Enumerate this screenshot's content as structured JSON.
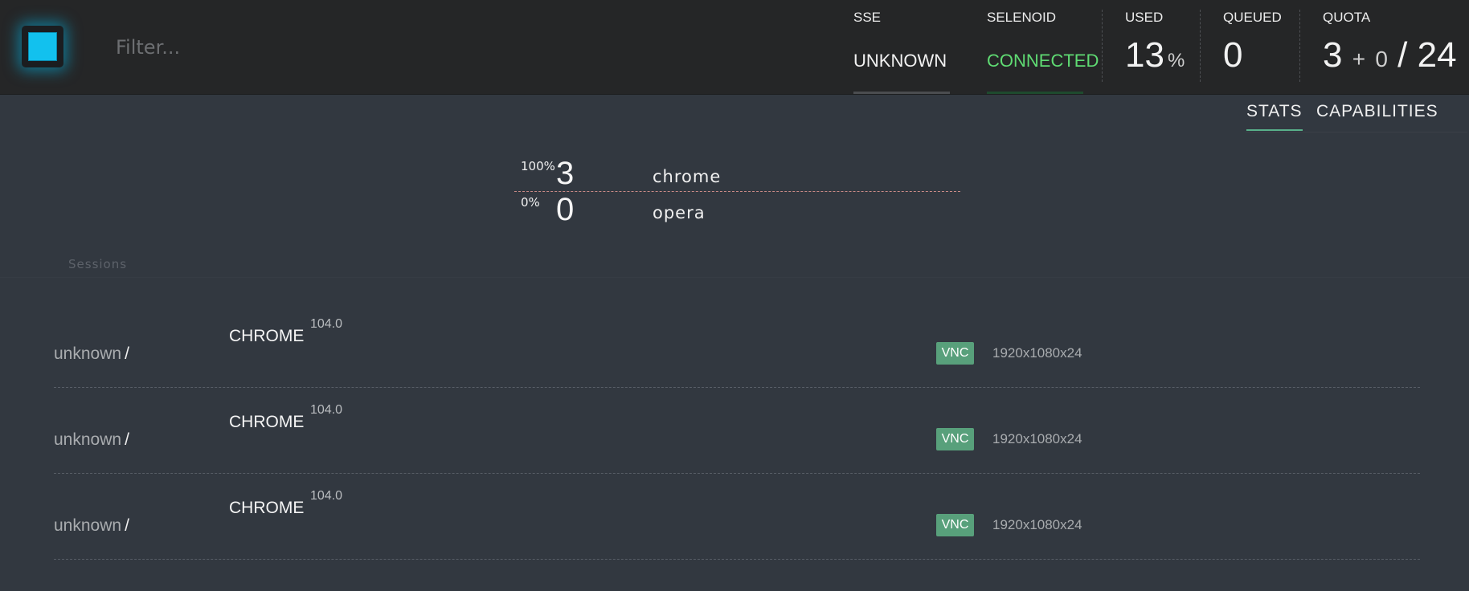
{
  "header": {
    "filter_placeholder": "Filter...",
    "sse": {
      "label": "SSE",
      "value": "UNKNOWN"
    },
    "selenoid": {
      "label": "SELENOID",
      "value": "CONNECTED",
      "color": "#5fdb73"
    },
    "used": {
      "label": "USED",
      "value": "13",
      "unit": "%"
    },
    "queued": {
      "label": "QUEUED",
      "value": "0"
    },
    "quota": {
      "label": "QUOTA",
      "used": "3",
      "plus": "+",
      "pending": "0",
      "slash": "/",
      "total": "24"
    }
  },
  "tabs": [
    {
      "label": "STATS",
      "active": true
    },
    {
      "label": "CAPABILITIES",
      "active": false
    }
  ],
  "browser_stats": [
    {
      "percent": "100%",
      "count": "3",
      "name": "chrome"
    },
    {
      "percent": "0%",
      "count": "0",
      "name": "opera"
    }
  ],
  "sessions": {
    "title": "Sessions",
    "rows": [
      {
        "user": "unknown",
        "slash": "/",
        "browser": "CHROME",
        "version": "104.0",
        "vnc": "VNC",
        "resolution": "1920x1080x24"
      },
      {
        "user": "unknown",
        "slash": "/",
        "browser": "CHROME",
        "version": "104.0",
        "vnc": "VNC",
        "resolution": "1920x1080x24"
      },
      {
        "user": "unknown",
        "slash": "/",
        "browser": "CHROME",
        "version": "104.0",
        "vnc": "VNC",
        "resolution": "1920x1080x24"
      }
    ]
  },
  "colors": {
    "accent_cyan": "#12c1ee",
    "connected_green": "#5fdb73",
    "vnc_badge": "#58a07b",
    "background": "#323840",
    "topbar": "#252627"
  },
  "icons": {
    "logo": "selenoid-square-logo"
  }
}
